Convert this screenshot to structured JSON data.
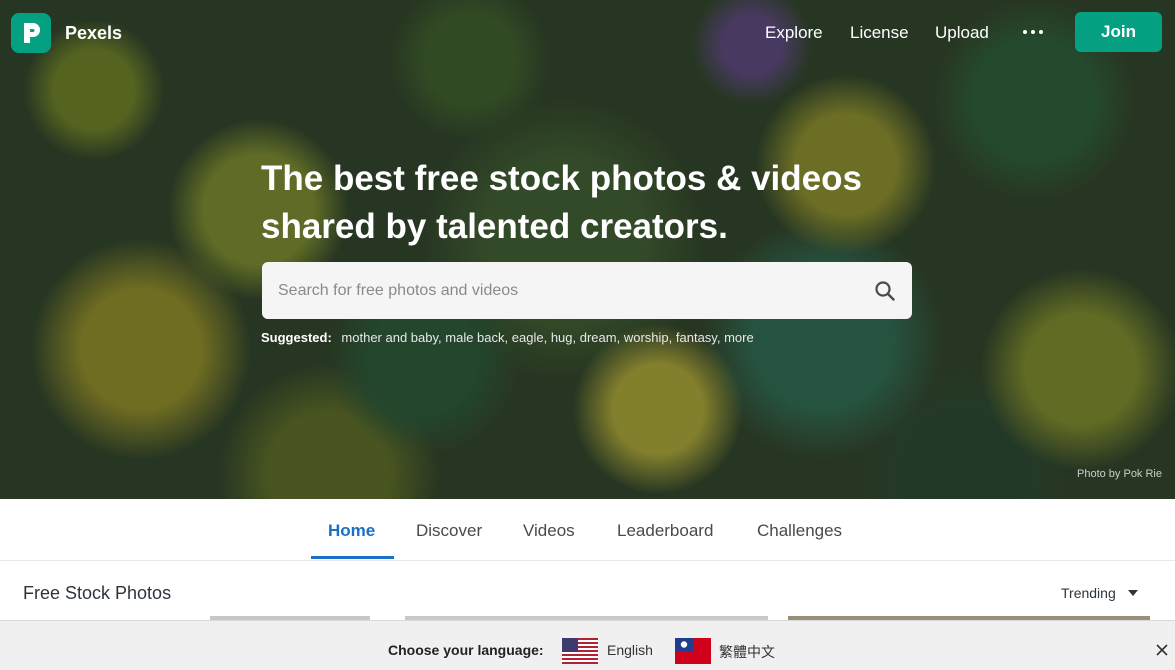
{
  "header": {
    "brand": "Pexels",
    "nav": {
      "explore": "Explore",
      "license": "License",
      "upload": "Upload"
    },
    "more_icon": "ellipsis-icon",
    "join_label": "Join",
    "accent_color": "#05a081"
  },
  "hero": {
    "headline_line1": "The best free stock photos & videos",
    "headline_line2": "shared by talented creators.",
    "search": {
      "placeholder": "Search for free photos and videos",
      "value": ""
    },
    "suggested_label": "Suggested:",
    "suggested": [
      "mother and baby,",
      "male back,",
      "eagle,",
      "hug,",
      "dream,",
      "worship,",
      "fantasy,",
      "more"
    ],
    "photo_credit": "Photo by Pok Rie"
  },
  "tabs": [
    {
      "label": "Home",
      "active": true
    },
    {
      "label": "Discover",
      "active": false
    },
    {
      "label": "Videos",
      "active": false
    },
    {
      "label": "Leaderboard",
      "active": false
    },
    {
      "label": "Challenges",
      "active": false
    }
  ],
  "section": {
    "title": "Free Stock Photos",
    "sort_label": "Trending"
  },
  "language_bar": {
    "label": "Choose your language:",
    "options": [
      {
        "label": "English",
        "flag": "us-flag-icon"
      },
      {
        "label": "繁體中文",
        "flag": "taiwan-flag-icon"
      }
    ]
  }
}
